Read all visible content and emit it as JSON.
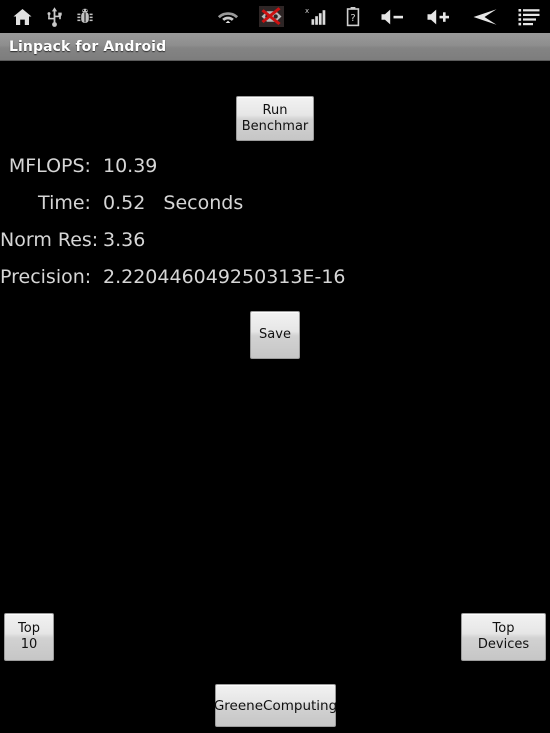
{
  "status_bar": {
    "left_icons": [
      {
        "name": "home-icon",
        "label": "Home"
      },
      {
        "name": "usb-icon",
        "label": "USB connected"
      },
      {
        "name": "debug-icon",
        "label": "USB debugging"
      }
    ],
    "right_icons": [
      {
        "name": "wifi-icon",
        "label": "Wi-Fi signal"
      },
      {
        "name": "no-sim-icon",
        "label": "No SIM card"
      },
      {
        "name": "signal-bars-icon",
        "label": "Mobile signal"
      },
      {
        "name": "battery-unknown-icon",
        "label": "Battery unknown"
      },
      {
        "name": "volume-down-icon",
        "label": "Volume down"
      },
      {
        "name": "volume-up-icon",
        "label": "Volume up"
      },
      {
        "name": "back-icon",
        "label": "Back"
      },
      {
        "name": "menu-icon",
        "label": "Menu"
      }
    ]
  },
  "title_bar": {
    "title": "Linpack for Android"
  },
  "buttons": {
    "run_benchmark": "Run\nBenchmar",
    "save": "Save",
    "top10": "Top\n10",
    "top_devices": "Top Devices",
    "greene_computing": "GreeneComputing"
  },
  "results": [
    {
      "label": "MFLOPS: ",
      "value": "10.39"
    },
    {
      "label": "Time: ",
      "value": "0.52   Seconds"
    },
    {
      "label": "Norm Res: ",
      "value": "3.36"
    },
    {
      "label": "Precision: ",
      "value": "2.220446049250313E-16"
    }
  ],
  "colors": {
    "background": "#000000",
    "status_bar": "#000000",
    "title_bar": "#8a8a8a",
    "title_text": "#ffffff",
    "result_text": "#d6d6d6",
    "button_face": "#e2e2e2",
    "button_text": "#111111",
    "no_sim_red": "#cc1111"
  }
}
